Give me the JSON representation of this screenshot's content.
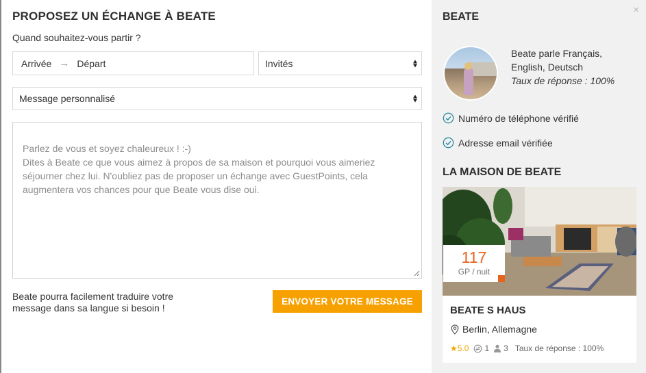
{
  "form": {
    "title": "PROPOSEZ UN ÉCHANGE À BEATE",
    "when_label": "Quand souhaitez-vous partir ?",
    "arrival_placeholder": "Arrivée",
    "arrow": "→",
    "departure_placeholder": "Départ",
    "guests_label": "Invités",
    "message_type_label": "Message personnalisé",
    "message_placeholder": "Parlez de vous et soyez chaleureux ! :-)\nDites à Beate ce que vous aimez à propos de sa maison et pourquoi vous aimeriez séjourner chez lui. N'oubliez pas de proposer un échange avec GuestPoints, cela augmentera vos chances pour que Beate vous dise oui.",
    "footnote": "Beate pourra facilement traduire votre message dans sa langue si besoin !",
    "send_label": "ENVOYER VOTRE MESSAGE"
  },
  "host": {
    "name": "BEATE",
    "languages": "Beate parle Français, English, Deutsch",
    "response_rate": "Taux de réponse : 100%",
    "phone_verified": "Numéro de téléphone vérifié",
    "email_verified": "Adresse email vérifiée"
  },
  "house": {
    "section_title": "LA MAISON DE BEATE",
    "price": "117",
    "price_unit": "GP / nuit",
    "name": "BEATE S HAUS",
    "location": "Berlin, Allemagne",
    "rating_star": "★",
    "rating": "5.0",
    "exchanges": "1",
    "capacity": "3",
    "response_rate": "Taux de réponse : 100%"
  },
  "close_label": "×",
  "colors": {
    "accent": "#f7a100",
    "price": "#e8631c",
    "verified": "#2a8aa0",
    "right_panel_bg": "#f1f1f1"
  },
  "icons": [
    "arrow-right",
    "select-arrows-icon",
    "check-circle-icon",
    "location-pin-icon",
    "star-icon",
    "exchange-icon",
    "person-icon",
    "close-icon"
  ]
}
